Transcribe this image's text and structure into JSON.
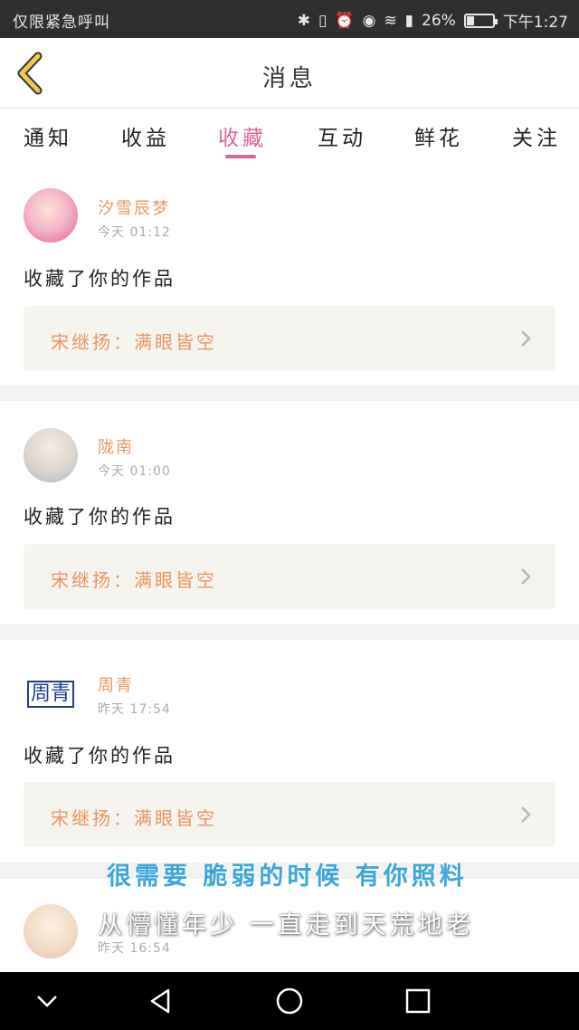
{
  "status_bar": {
    "left_text": "仅限紧急呼叫",
    "battery_percent": "26%",
    "battery_level": 0.26,
    "time": "下午1:27",
    "icons": [
      "bluetooth-icon",
      "vibrate-icon",
      "alarm-icon",
      "eye-icon",
      "wifi-icon",
      "signal-icon",
      "battery-icon"
    ]
  },
  "header": {
    "title": "消息",
    "back_icon": "chevron-left-icon"
  },
  "tabs": [
    {
      "label": "通知",
      "active": false
    },
    {
      "label": "收益",
      "active": false
    },
    {
      "label": "收藏",
      "active": true
    },
    {
      "label": "互动",
      "active": false
    },
    {
      "label": "鲜花",
      "active": false
    },
    {
      "label": "关注",
      "active": false
    }
  ],
  "messages": [
    {
      "username": "汐雪辰梦",
      "time": "今天 01:12",
      "action": "收藏了你的作品",
      "work": "宋继扬：满眼皆空"
    },
    {
      "username": "陇南",
      "time": "今天 01:00",
      "action": "收藏了你的作品",
      "work": "宋继扬：满眼皆空"
    },
    {
      "username": "周青",
      "avatar_text": "周青",
      "time": "昨天 17:54",
      "action": "收藏了你的作品",
      "work": "宋继扬：满眼皆空"
    },
    {
      "username": "",
      "time": "昨天 16:54"
    }
  ],
  "lyrics": {
    "line1": "很需要 脆弱的时候 有你照料",
    "line2": "从懵懂年少 一直走到天荒地老"
  },
  "colors": {
    "accent": "#d9669a",
    "username": "#e79a63",
    "work_text": "#e99560",
    "work_bg": "#f5f4ee",
    "back_arrow": "#f2c94c"
  }
}
